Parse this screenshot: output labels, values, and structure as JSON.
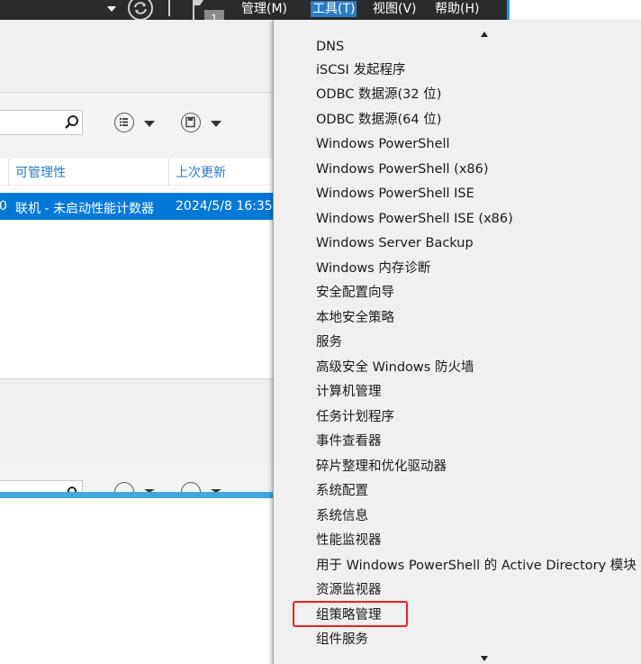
{
  "menubar": {
    "items": [
      "管理(M)",
      "工具(T)",
      "视图(V)",
      "帮助(H)"
    ],
    "active_index": 1,
    "notification_count": "1"
  },
  "server_list": {
    "columns": [
      "可管理性",
      "上次更新"
    ],
    "selected_row": {
      "prefix": "0",
      "manageability": "联机 - 未启动性能计数器",
      "last_update": "2024/5/8 16:35"
    }
  },
  "tools_menu": {
    "items": [
      "DNS",
      "iSCSI 发起程序",
      "ODBC 数据源(32 位)",
      "ODBC 数据源(64 位)",
      "Windows PowerShell",
      "Windows PowerShell (x86)",
      "Windows PowerShell ISE",
      "Windows PowerShell ISE (x86)",
      "Windows Server Backup",
      "Windows 内存诊断",
      "安全配置向导",
      "本地安全策略",
      "服务",
      "高级安全 Windows 防火墙",
      "计算机管理",
      "任务计划程序",
      "事件查看器",
      "碎片整理和优化驱动器",
      "系统配置",
      "系统信息",
      "性能监视器",
      "用于 Windows PowerShell 的 Active Directory 模块",
      "资源监视器",
      "组策略管理",
      "组件服务"
    ],
    "highlighted_item": "组策略管理"
  }
}
